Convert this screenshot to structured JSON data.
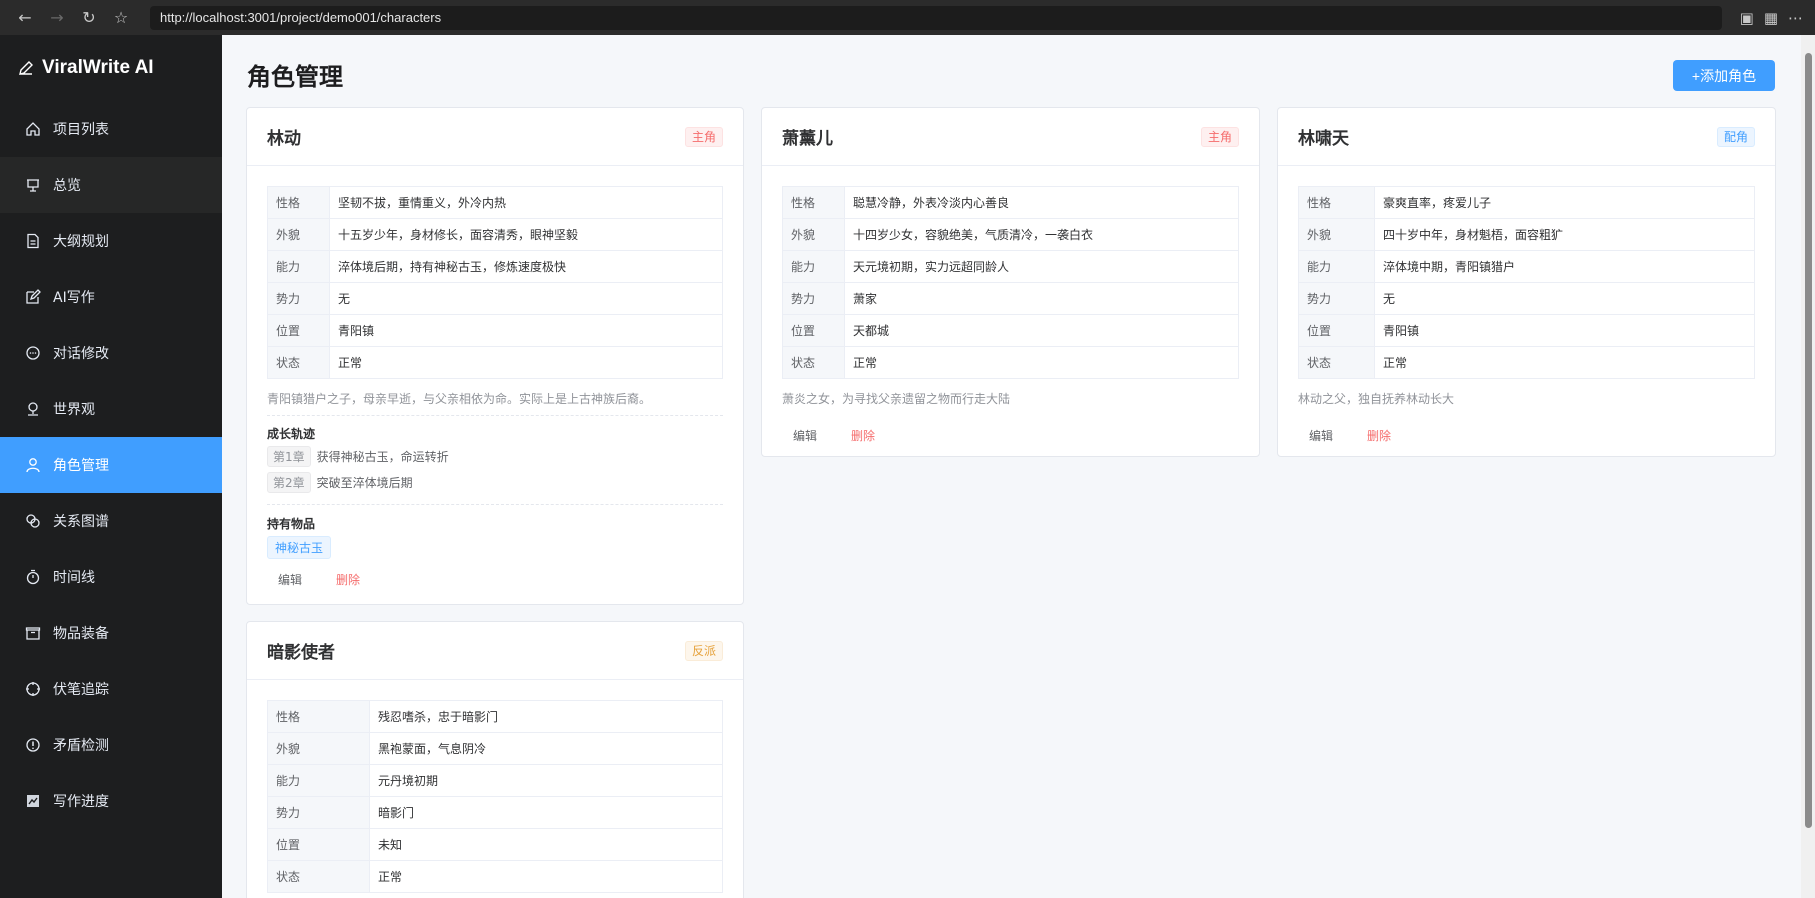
{
  "browser": {
    "url": "http://localhost:3001/project/demo001/characters"
  },
  "app": {
    "logo": "ViralWrite AI"
  },
  "sidebar": {
    "items": [
      {
        "label": "项目列表",
        "icon": "home-icon"
      },
      {
        "label": "总览",
        "icon": "presentation-icon"
      },
      {
        "label": "大纲规划",
        "icon": "document-icon"
      },
      {
        "label": "AI写作",
        "icon": "edit-icon"
      },
      {
        "label": "对话修改",
        "icon": "chat-icon"
      },
      {
        "label": "世界观",
        "icon": "map-pin-icon"
      },
      {
        "label": "角色管理",
        "icon": "user-icon"
      },
      {
        "label": "关系图谱",
        "icon": "link-icon"
      },
      {
        "label": "时间线",
        "icon": "stopwatch-icon"
      },
      {
        "label": "物品装备",
        "icon": "box-icon"
      },
      {
        "label": "伏笔追踪",
        "icon": "target-icon"
      },
      {
        "label": "矛盾检测",
        "icon": "warning-icon"
      },
      {
        "label": "写作进度",
        "icon": "chart-icon"
      }
    ],
    "active_index": 6
  },
  "main": {
    "title": "角色管理",
    "add_button": "+添加角色",
    "edit_label": "编辑",
    "delete_label": "删除",
    "growth_label": "成长轨迹",
    "items_label": "持有物品"
  },
  "characters": [
    {
      "name": "林动",
      "role": "主角",
      "attrs": [
        {
          "k": "性格",
          "v": "坚韧不拔，重情重义，外冷内热"
        },
        {
          "k": "外貌",
          "v": "十五岁少年，身材修长，面容清秀，眼神坚毅"
        },
        {
          "k": "能力",
          "v": "淬体境后期，持有神秘古玉，修炼速度极快"
        },
        {
          "k": "势力",
          "v": "无"
        },
        {
          "k": "位置",
          "v": "青阳镇"
        },
        {
          "k": "状态",
          "v": "正常"
        }
      ],
      "desc": "青阳镇猎户之子，母亲早逝，与父亲相依为命。实际上是上古神族后裔。",
      "growth": [
        {
          "chapter": "第1章",
          "text": "获得神秘古玉，命运转折"
        },
        {
          "chapter": "第2章",
          "text": "突破至淬体境后期"
        }
      ],
      "items": [
        "神秘古玉"
      ]
    },
    {
      "name": "萧薰儿",
      "role": "主角",
      "attrs": [
        {
          "k": "性格",
          "v": "聪慧冷静，外表冷淡内心善良"
        },
        {
          "k": "外貌",
          "v": "十四岁少女，容貌绝美，气质清冷，一袭白衣"
        },
        {
          "k": "能力",
          "v": "天元境初期，实力远超同龄人"
        },
        {
          "k": "势力",
          "v": "萧家"
        },
        {
          "k": "位置",
          "v": "天都城"
        },
        {
          "k": "状态",
          "v": "正常"
        }
      ],
      "desc": "萧炎之女，为寻找父亲遗留之物而行走大陆"
    },
    {
      "name": "林啸天",
      "role": "配角",
      "attrs": [
        {
          "k": "性格",
          "v": "豪爽直率，疼爱儿子"
        },
        {
          "k": "外貌",
          "v": "四十岁中年，身材魁梧，面容粗犷"
        },
        {
          "k": "能力",
          "v": "淬体境中期，青阳镇猎户"
        },
        {
          "k": "势力",
          "v": "无"
        },
        {
          "k": "位置",
          "v": "青阳镇"
        },
        {
          "k": "状态",
          "v": "正常"
        }
      ],
      "desc": "林动之父，独自抚养林动长大"
    },
    {
      "name": "暗影使者",
      "role": "反派",
      "attrs": [
        {
          "k": "性格",
          "v": "残忍嗜杀，忠于暗影门"
        },
        {
          "k": "外貌",
          "v": "黑袍蒙面，气息阴冷"
        },
        {
          "k": "能力",
          "v": "元丹境初期"
        },
        {
          "k": "势力",
          "v": "暗影门"
        },
        {
          "k": "位置",
          "v": "未知"
        },
        {
          "k": "状态",
          "v": "正常"
        }
      ]
    }
  ],
  "colors": {
    "accent": "#409eff",
    "danger": "#f56c6c",
    "warning": "#e6a23c",
    "sidebar_bg": "#1d1e1f"
  }
}
